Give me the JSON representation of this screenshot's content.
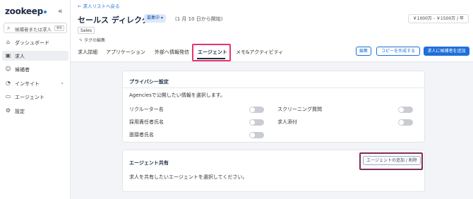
{
  "sidebar": {
    "logo": "zookeep",
    "collapse_icon": "double-chevron-left",
    "search": {
      "placeholder": "候補者または求人",
      "shortcut": "⌘K"
    },
    "items": [
      {
        "label": "ダッシュボード",
        "icon": "home"
      },
      {
        "label": "求人",
        "icon": "briefcase",
        "active": true
      },
      {
        "label": "候補者",
        "icon": "user"
      },
      {
        "label": "インサイト",
        "icon": "chart"
      },
      {
        "label": "エージェント",
        "icon": "agent"
      },
      {
        "label": "設定",
        "icon": "gear"
      }
    ]
  },
  "header": {
    "back_link": "← 求人リストへ戻る",
    "title": "セールス ディレクター",
    "status": "募集中 ▾",
    "since": "(1 月 10 日から開始)",
    "salary": "￥1000万 - ￥1500万 / 年",
    "tag": "Sales",
    "tag_edit": "タグの編集"
  },
  "tabs": [
    {
      "label": "求人詳細"
    },
    {
      "label": "アプリケーション"
    },
    {
      "label": "外部へ情報発信"
    },
    {
      "label": "エージェント",
      "active": true
    },
    {
      "label": "メモ&アクティビティ"
    }
  ],
  "actions": {
    "edit": "編集",
    "create_copy": "コピーを作成する",
    "add_candidate": "求人に候補者を追加"
  },
  "privacy": {
    "title": "プライバシー設定",
    "description": "Agenciesで公開したい情報を選択します。",
    "options": [
      {
        "label": "リクルーター名",
        "enabled": false
      },
      {
        "label": "採用責任者氏名",
        "enabled": false
      },
      {
        "label": "面接者氏名",
        "enabled": false
      },
      {
        "label": "スクリーニング質問",
        "enabled": false
      },
      {
        "label": "求人添付",
        "enabled": false
      }
    ]
  },
  "agent_share": {
    "title": "エージェント共有",
    "description": "求人を共有したいエージェントを選択してください。",
    "button": "エージェントの追加 / 削除"
  },
  "colors": {
    "accent": "#1e6fd9",
    "highlight_tab": "#e8336d",
    "highlight_button": "#7d2d58"
  }
}
